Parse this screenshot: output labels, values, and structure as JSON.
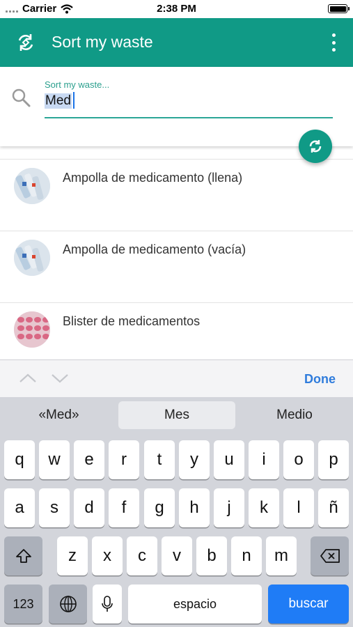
{
  "status": {
    "carrier": "Carrier",
    "time": "2:38 PM"
  },
  "app_bar": {
    "title": "Sort my waste"
  },
  "search": {
    "label": "Sort my waste...",
    "value": "Med"
  },
  "results": [
    {
      "label": "Ampolla de medicamento (llena)",
      "image": "medicine-ampoule-image"
    },
    {
      "label": "Ampolla de medicamento (vacía)",
      "image": "medicine-ampoule-image"
    },
    {
      "label": "Blister de medicamentos",
      "image": "pill-blister-image"
    }
  ],
  "accessory": {
    "done_label": "Done"
  },
  "keyboard": {
    "suggestions": [
      "«Med»",
      "Mes",
      "Medio"
    ],
    "row1": [
      "q",
      "w",
      "e",
      "r",
      "t",
      "y",
      "u",
      "i",
      "o",
      "p"
    ],
    "row2": [
      "a",
      "s",
      "d",
      "f",
      "g",
      "h",
      "j",
      "k",
      "l",
      "ñ"
    ],
    "row3": [
      "z",
      "x",
      "c",
      "v",
      "b",
      "n",
      "m"
    ],
    "numbers_label": "123",
    "space_label": "espacio",
    "action_label": "buscar"
  },
  "colors": {
    "primary": "#109a86",
    "accent_blue": "#1f7cf6",
    "done_blue": "#2f7cdc"
  }
}
